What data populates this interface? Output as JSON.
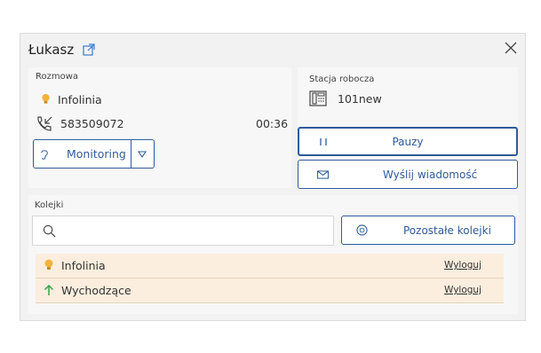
{
  "header": {
    "title": "Łukasz"
  },
  "call": {
    "section_label": "Rozmowa",
    "queue_name": "Infolinia",
    "phone_number": "583509072",
    "duration": "00:36",
    "monitoring_label": "Monitoring"
  },
  "workstation": {
    "section_label": "Stacja robocza",
    "name": "101new",
    "pause_label": "Pauzy",
    "send_message_label": "Wyślij wiadomość"
  },
  "queues": {
    "section_label": "Kolejki",
    "search_placeholder": "",
    "other_queues_label": "Pozostałe kolejki",
    "items": [
      {
        "name": "Infolinia",
        "action": "Wyloguj",
        "icon": "lightbulb-icon"
      },
      {
        "name": "Wychodzące",
        "action": "Wyloguj",
        "icon": "arrow-up-icon"
      }
    ]
  },
  "colors": {
    "accent": "#2e5b9a",
    "row_bg": "#fbeede",
    "bulb": "#f2b33d",
    "arrow": "#3aa04a"
  }
}
